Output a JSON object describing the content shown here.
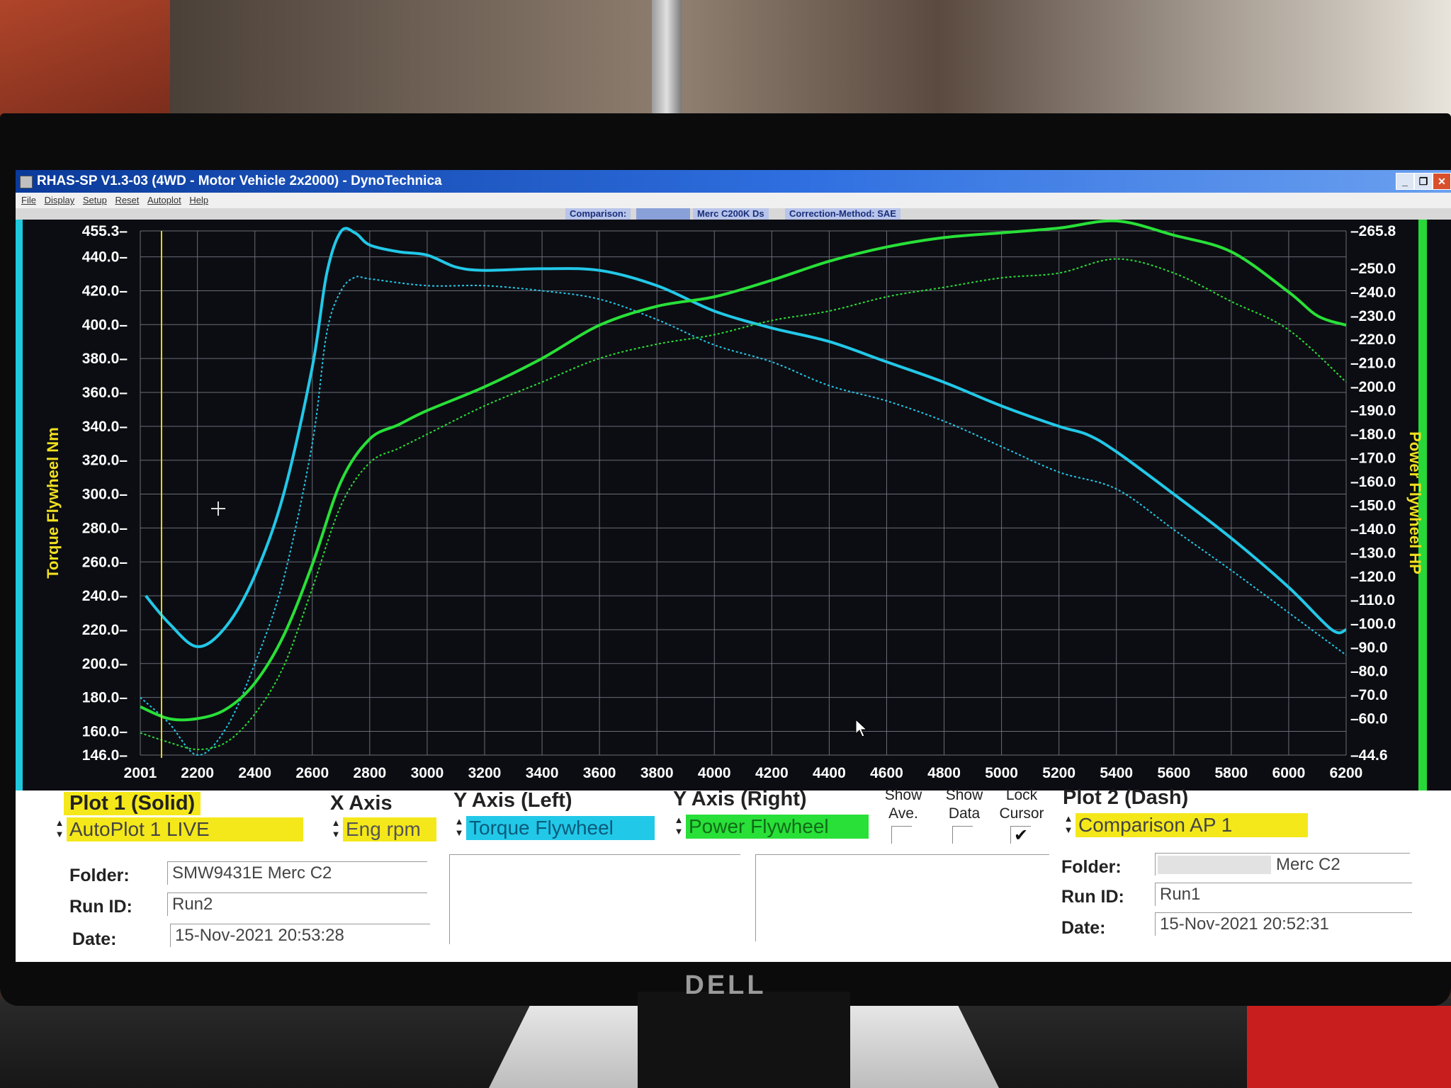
{
  "window": {
    "title": "RHAS-SP V1.3-03  (4WD - Motor Vehicle 2x2000) - DynoTechnica",
    "buttons": [
      "_",
      "❐",
      "✕"
    ]
  },
  "menu": [
    "File",
    "Display",
    "Setup",
    "Reset",
    "Autoplot",
    "Help"
  ],
  "infobar": {
    "comparison_label": "Comparison:",
    "comparison_value": "Merc C200K Ds",
    "correction": "Correction-Method: SAE"
  },
  "monitor_brand": "DELL",
  "chart_data": {
    "type": "line",
    "xlabel": "",
    "ylabel_left": "Torque Flywheel Nm",
    "ylabel_right": "Power Flywheel HP",
    "xlim": [
      2001,
      6200
    ],
    "ylim_left": [
      146.0,
      455.3
    ],
    "ylim_right": [
      44.6,
      265.8
    ],
    "x_ticks": [
      "2001",
      "2200",
      "2400",
      "2600",
      "2800",
      "3000",
      "3200",
      "3400",
      "3600",
      "3800",
      "4000",
      "4200",
      "4400",
      "4600",
      "4800",
      "5000",
      "5200",
      "5400",
      "5600",
      "5800",
      "6000",
      "6200"
    ],
    "y_left_ticks": [
      "146.0",
      "160.0",
      "180.0",
      "200.0",
      "220.0",
      "240.0",
      "260.0",
      "280.0",
      "300.0",
      "320.0",
      "340.0",
      "360.0",
      "380.0",
      "400.0",
      "420.0",
      "440.0",
      "455.3"
    ],
    "y_right_ticks": [
      "44.6",
      "60.0",
      "70.0",
      "80.0",
      "90.0",
      "100.0",
      "110.0",
      "120.0",
      "130.0",
      "140.0",
      "150.0",
      "160.0",
      "170.0",
      "180.0",
      "190.0",
      "200.0",
      "210.0",
      "220.0",
      "230.0",
      "240.0",
      "250.0",
      "265.8"
    ],
    "grid": true,
    "cursor_rpm": 2075,
    "series": [
      {
        "axis": "left",
        "style": "solid",
        "color": "#22c8e8",
        "x": [
          2020,
          2100,
          2200,
          2300,
          2400,
          2500,
          2600,
          2650,
          2700,
          2750,
          2800,
          2900,
          3000,
          3100,
          3200,
          3400,
          3600,
          3800,
          4000,
          4200,
          4400,
          4600,
          4800,
          5000,
          5200,
          5300,
          5400,
          5600,
          5800,
          6000,
          6150,
          6200
        ],
        "values": [
          240,
          224,
          210,
          222,
          252,
          300,
          375,
          430,
          455,
          454,
          447,
          443,
          441,
          434,
          432,
          433,
          432,
          423,
          408,
          398,
          390,
          378,
          366,
          352,
          340,
          335,
          325,
          300,
          274,
          245,
          220,
          220
        ]
      },
      {
        "axis": "left",
        "style": "dash",
        "color": "#22c8e8",
        "x": [
          2001,
          2100,
          2200,
          2300,
          2400,
          2500,
          2600,
          2650,
          2700,
          2750,
          2800,
          3000,
          3200,
          3400,
          3600,
          3800,
          4000,
          4200,
          4400,
          4600,
          4800,
          5000,
          5200,
          5400,
          5600,
          5800,
          6000,
          6200
        ],
        "values": [
          180,
          165,
          146,
          162,
          200,
          250,
          330,
          395,
          420,
          428,
          427,
          423,
          423,
          420,
          415,
          403,
          388,
          378,
          364,
          355,
          343,
          328,
          313,
          303,
          279,
          255,
          230,
          205
        ]
      },
      {
        "axis": "right",
        "style": "solid",
        "color": "#28e038",
        "x": [
          2001,
          2100,
          2200,
          2300,
          2400,
          2500,
          2600,
          2700,
          2800,
          2900,
          3000,
          3200,
          3400,
          3600,
          3800,
          4000,
          4200,
          4400,
          4600,
          4800,
          5000,
          5200,
          5400,
          5600,
          5800,
          6000,
          6100,
          6200
        ],
        "values": [
          65,
          60,
          60,
          64,
          75,
          95,
          125,
          160,
          178,
          184,
          190,
          200,
          212,
          226,
          234,
          238,
          245,
          253,
          259,
          263,
          265,
          267,
          270,
          264,
          257,
          240,
          230,
          226
        ]
      },
      {
        "axis": "right",
        "style": "dash",
        "color": "#28e038",
        "x": [
          2001,
          2100,
          2200,
          2300,
          2400,
          2500,
          2600,
          2700,
          2800,
          2900,
          3000,
          3200,
          3400,
          3600,
          3800,
          4000,
          4200,
          4400,
          4600,
          4800,
          5000,
          5200,
          5400,
          5600,
          5800,
          6000,
          6200
        ],
        "values": [
          54,
          50,
          47,
          50,
          62,
          82,
          115,
          150,
          168,
          174,
          180,
          192,
          202,
          212,
          218,
          222,
          228,
          232,
          238,
          242,
          246,
          248,
          254,
          248,
          236,
          224,
          202
        ]
      }
    ]
  },
  "bottom_panel": {
    "plot1_title": "Plot 1 (Solid)",
    "plot1_select": "AutoPlot 1 LIVE",
    "x_axis_title": "X Axis",
    "x_axis_select": "Eng rpm",
    "y_left_title": "Y Axis (Left)",
    "y_left_select": "Torque Flywheel",
    "y_right_title": "Y Axis (Right)",
    "y_right_select": "Power Flywheel",
    "show_ave": "Show Ave.",
    "show_data": "Show Data",
    "lock_cursor": "Lock Cursor",
    "lock_cursor_checked": "✔",
    "plot2_title": "Plot 2 (Dash)",
    "plot2_select": "Comparison AP 1",
    "folder_label": "Folder:",
    "runid_label": "Run ID:",
    "date_label": "Date:",
    "plot1_folder": "SMW9431E Merc C2",
    "plot1_runid": "Run2",
    "plot1_date": "15-Nov-2021  20:53:28",
    "plot2_folder": "Merc C2",
    "plot2_runid": "Run1",
    "plot2_date": "15-Nov-2021  20:52:31",
    "color_yellow": "#f4e81a",
    "color_cyan": "#22c8e8",
    "color_green": "#28e038"
  }
}
